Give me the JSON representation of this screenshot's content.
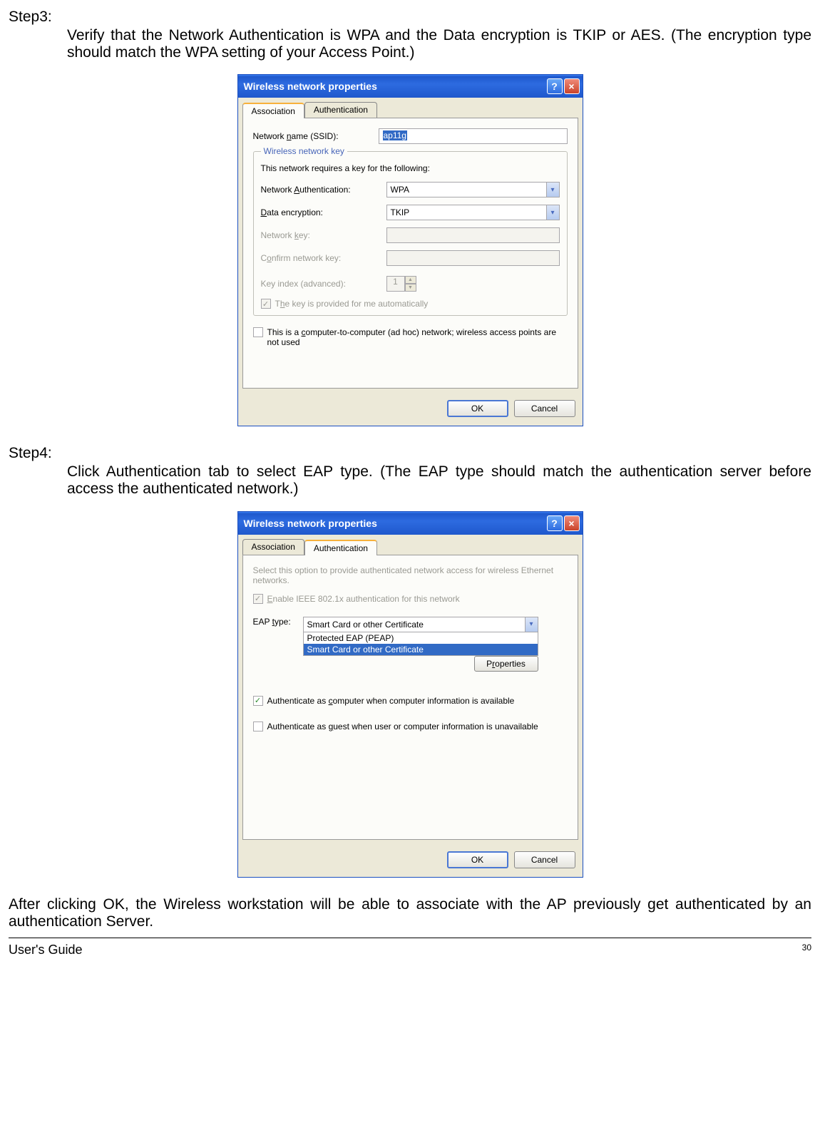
{
  "doc": {
    "step3_label": "Step3:",
    "step3_body": "Verify that the Network Authentication is WPA and the Data encryption is TKIP or AES. (The encryption type should match the WPA setting of your Access Point.)",
    "step4_label": "Step4:",
    "step4_body": "Click Authentication tab to select EAP type. (The EAP type should match the authentication server before access the authenticated network.)",
    "conclusion": "After clicking OK, the Wireless workstation will be able to associate with the AP previously get authenticated by an authentication Server.",
    "footer_left": "User's Guide",
    "footer_page": "30"
  },
  "dialog1": {
    "title": "Wireless network properties",
    "help": "?",
    "close": "×",
    "tab_assoc": "Association",
    "tab_auth": "Authentication",
    "ssid_label_pre": "Network ",
    "ssid_label_hk": "n",
    "ssid_label_post": "ame (SSID):",
    "ssid_value": "ap11g",
    "legend": "Wireless network key",
    "desc": "This network requires a key for the following:",
    "netauth_label_pre": "Network ",
    "netauth_label_hk": "A",
    "netauth_label_post": "uthentication:",
    "netauth_value": "WPA",
    "dataenc_label_hk": "D",
    "dataenc_label_post": "ata encryption:",
    "dataenc_value": "TKIP",
    "netkey_label_pre": "Network ",
    "netkey_label_hk": "k",
    "netkey_label_post": "ey:",
    "confirm_label_hk": "o",
    "confirm_label_pre": "C",
    "confirm_label_post": "nfirm network key:",
    "keyidx_label": "Key index (advanced):",
    "keyidx_value": "1",
    "autokey_pre": "T",
    "autokey_hk": "h",
    "autokey_post": "e key is provided for me automatically",
    "adhoc_pre": "This is a ",
    "adhoc_hk": "c",
    "adhoc_post": "omputer-to-computer (ad hoc) network; wireless access points are not used",
    "ok": "OK",
    "cancel": "Cancel"
  },
  "dialog2": {
    "title": "Wireless network properties",
    "help": "?",
    "close": "×",
    "tab_assoc": "Association",
    "tab_auth": "Authentication",
    "desc": "Select this option to provide authenticated network access for wireless Ethernet networks.",
    "enable_hk": "E",
    "enable_post": "nable IEEE 802.1x authentication for this network",
    "eap_label_pre": "EAP ",
    "eap_label_hk": "t",
    "eap_label_post": "ype:",
    "eap_selected": "Smart Card or other Certificate",
    "eap_opt1": "Protected EAP (PEAP)",
    "eap_opt2": "Smart Card or other Certificate",
    "properties_hk": "r",
    "properties_pre": "P",
    "properties_post": "operties",
    "authcomp_pre": "Authenticate as ",
    "authcomp_hk": "c",
    "authcomp_post": "omputer when computer information is available",
    "authguest_pre": "Authenticate as ",
    "authguest_hk": "g",
    "authguest_post": "uest when user or computer information is unavailable",
    "ok": "OK",
    "cancel": "Cancel"
  }
}
